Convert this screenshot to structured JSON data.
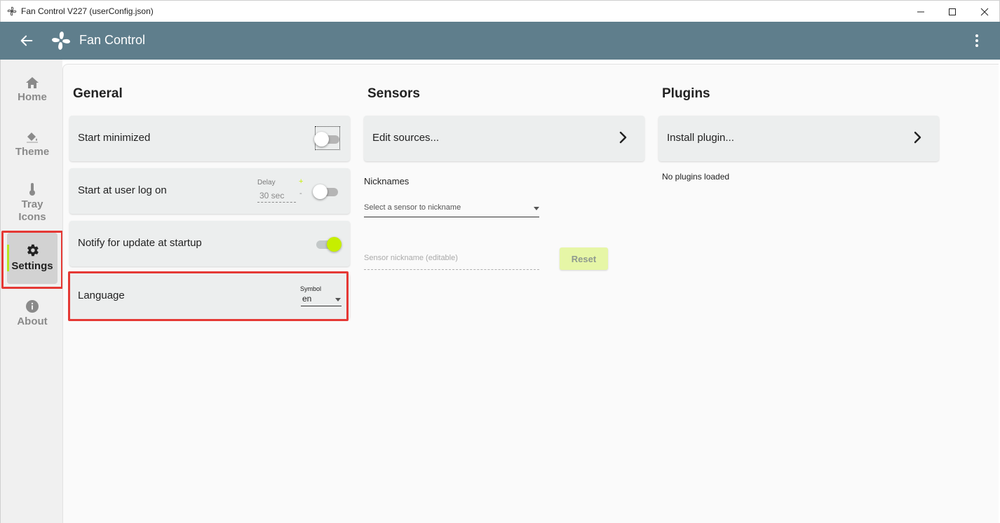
{
  "window": {
    "title": "Fan Control V227 (userConfig.json)",
    "icons": {
      "app": "fan-icon",
      "minimize": "minimize-icon",
      "maximize": "maximize-icon",
      "close": "close-icon"
    }
  },
  "appbar": {
    "title": "Fan Control",
    "icons": {
      "back": "arrow-left-icon",
      "logo": "fan-logo-icon",
      "menu": "more-vertical-icon"
    },
    "color": "#5f7e8c"
  },
  "sidebar": {
    "items": [
      {
        "label": "Home",
        "icon": "home-icon"
      },
      {
        "label": "Theme",
        "icon": "paint-bucket-icon"
      },
      {
        "label": "Tray Icons",
        "icon": "thermometer-icon"
      },
      {
        "label": "Settings",
        "icon": "gear-icon",
        "active": true
      },
      {
        "label": "About",
        "icon": "info-icon"
      }
    ]
  },
  "general": {
    "title": "General",
    "start_minimized": {
      "label": "Start minimized",
      "enabled": false
    },
    "start_at_logon": {
      "label": "Start at user log on",
      "delay_label": "Delay",
      "delay_value": "30 sec",
      "plus": "+",
      "minus": "-",
      "enabled": false
    },
    "notify_update": {
      "label": "Notify for update at startup",
      "enabled": true
    },
    "language": {
      "label": "Language",
      "field_label": "Symbol",
      "value": "en"
    }
  },
  "sensors": {
    "title": "Sensors",
    "edit_sources": "Edit sources...",
    "nicknames_label": "Nicknames",
    "sensor_select_placeholder": "Select a sensor to nickname",
    "nickname_placeholder": "Sensor nickname (editable)",
    "reset_label": "Reset"
  },
  "plugins": {
    "title": "Plugins",
    "install": "Install plugin...",
    "status": "No plugins loaded"
  },
  "colors": {
    "accent": "#c6ee00",
    "highlight": "#e53935"
  }
}
